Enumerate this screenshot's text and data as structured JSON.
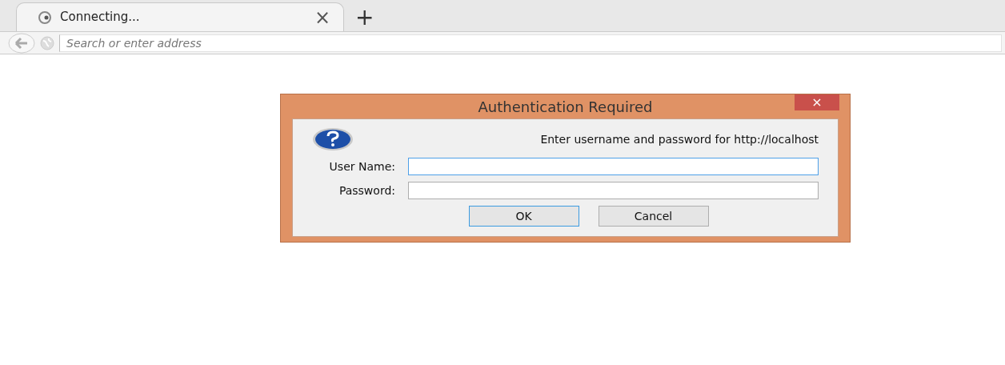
{
  "tabs": [
    {
      "title": "Connecting...",
      "close": "×",
      "selected": true
    }
  ],
  "new_tab": "+",
  "address_bar": {
    "placeholder": "Search or enter address"
  },
  "dialog": {
    "title": "Authentication Required",
    "close": "×",
    "message": "Enter username and password for http://localhost",
    "fields": [
      {
        "label": "User Name:",
        "focused": true
      },
      {
        "label": "Password:",
        "focused": false
      }
    ],
    "buttons": [
      {
        "label": "OK",
        "default": true
      },
      {
        "label": "Cancel",
        "default": false
      }
    ]
  }
}
